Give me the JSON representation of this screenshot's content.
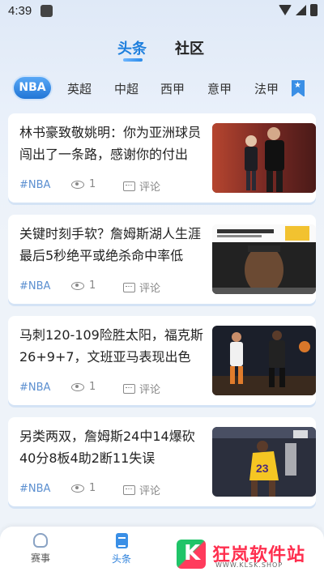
{
  "status_bar": {
    "time": "4:39"
  },
  "top_tabs": [
    {
      "label": "头条",
      "active": true
    },
    {
      "label": "社区",
      "active": false
    }
  ],
  "categories": [
    {
      "label": "NBA",
      "active": true
    },
    {
      "label": "英超"
    },
    {
      "label": "中超"
    },
    {
      "label": "西甲"
    },
    {
      "label": "意甲"
    },
    {
      "label": "法甲"
    }
  ],
  "category_action_icon": "bookmark-star-icon",
  "articles": [
    {
      "title": "林书豪致敬姚明：你为亚洲球员闯出了一条路，感谢你的付出",
      "tag": "#NBA",
      "views": "1",
      "comment_label": "评论",
      "thumb": "two-players-photo"
    },
    {
      "title": "关键时刻手软？詹姆斯湖人生涯最后5秒绝平或绝杀命中率低",
      "tag": "#NBA",
      "views": "1",
      "comment_label": "评论",
      "thumb": "lebron-graphic"
    },
    {
      "title": "马刺120-109险胜太阳，福克斯26+9+7，文班亚马表现出色",
      "tag": "#NBA",
      "views": "1",
      "comment_label": "评论",
      "thumb": "game-action-photo"
    },
    {
      "title": "另类两双，詹姆斯24中14爆砍40分8板4助2断11失误",
      "tag": "#NBA",
      "views": "1",
      "comment_label": "评论",
      "thumb": "lakers-dunk-photo"
    }
  ],
  "bottom_nav": [
    {
      "label": "赛事",
      "icon": "trophy-icon",
      "active": false
    },
    {
      "label": "头条",
      "icon": "news-icon",
      "active": true
    }
  ],
  "watermark": {
    "text": "狂岚软件站",
    "url": "WWW.KLSK.SHOP"
  },
  "colors": {
    "accent": "#1e7fdd",
    "tag": "#5b8fd0",
    "meta": "#888888"
  }
}
